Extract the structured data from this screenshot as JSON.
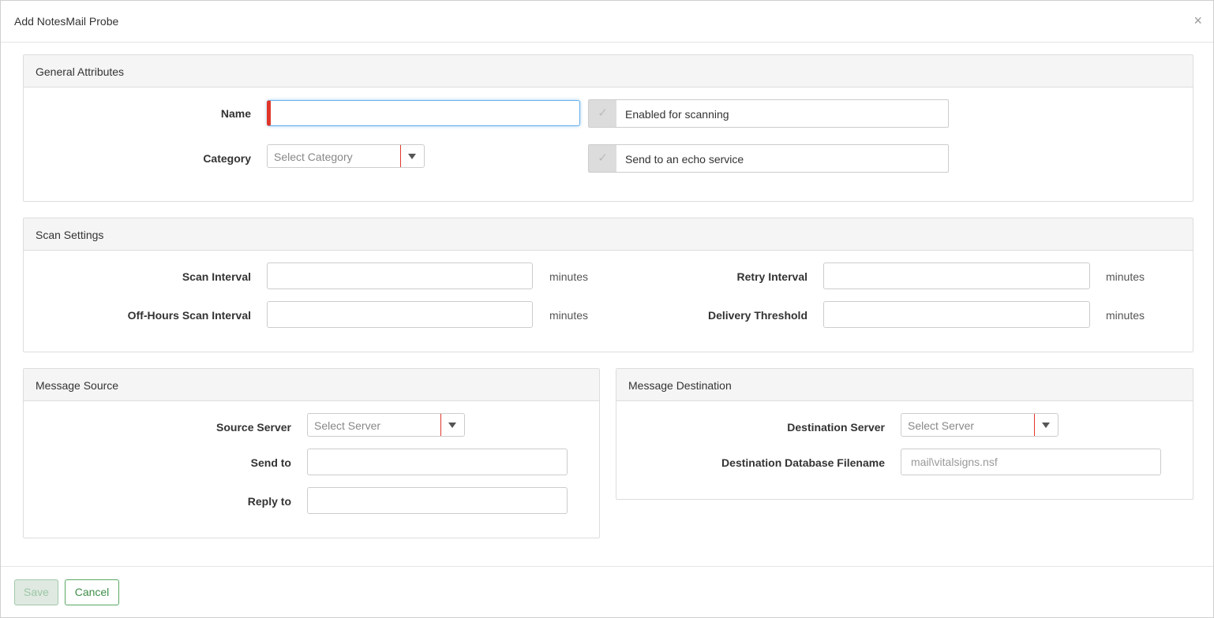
{
  "dialog": {
    "title": "Add NotesMail Probe",
    "close_symbol": "×"
  },
  "general": {
    "title": "General Attributes",
    "name_label": "Name",
    "name_value": "",
    "category_label": "Category",
    "category_placeholder": "Select Category",
    "enabled_label": "Enabled for scanning",
    "echo_label": "Send to an echo service",
    "check_symbol": "✓"
  },
  "scan": {
    "title": "Scan Settings",
    "scan_interval_label": "Scan Interval",
    "offhours_label": "Off-Hours Scan Interval",
    "retry_label": "Retry Interval",
    "delivery_label": "Delivery Threshold",
    "unit": "minutes",
    "scan_interval_value": "",
    "offhours_value": "",
    "retry_value": "",
    "delivery_value": ""
  },
  "source": {
    "title": "Message Source",
    "server_label": "Source Server",
    "server_placeholder": "Select Server",
    "sendto_label": "Send to",
    "replyto_label": "Reply to",
    "sendto_value": "",
    "replyto_value": ""
  },
  "destination": {
    "title": "Message Destination",
    "server_label": "Destination Server",
    "server_placeholder": "Select Server",
    "db_label": "Destination Database Filename",
    "db_placeholder": "mail\\vitalsigns.nsf"
  },
  "footer": {
    "save_label": "Save",
    "cancel_label": "Cancel"
  },
  "colors": {
    "required_marker": "#e0362a",
    "primary_green": "#5aa863",
    "panel_header_bg": "#f5f5f5"
  }
}
